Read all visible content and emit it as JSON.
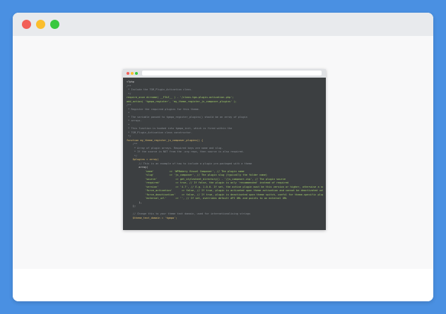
{
  "code": {
    "lines": [
      {
        "text": "<?php",
        "kind": "plain"
      },
      {
        "text": "/**",
        "kind": "comment"
      },
      {
        "text": " * Include the TGM_Plugin_Activation class.",
        "kind": "comment"
      },
      {
        "text": " */",
        "kind": "comment"
      },
      {
        "text": "require_once dirname( __FILE__ ) . '/class-tgm-plugin-activation.php';",
        "kind": "string"
      },
      {
        "text": "add_action( 'tgmpa_register', 'my_theme_register_js_composer_plugins' );",
        "kind": "string"
      },
      {
        "text": "/**",
        "kind": "comment"
      },
      {
        "text": " * Register the required plugins for this theme.",
        "kind": "comment"
      },
      {
        "text": " *",
        "kind": "comment"
      },
      {
        "text": " * The variable passed to tgmpa_register_plugins() should be an array of plugin",
        "kind": "comment"
      },
      {
        "text": " * arrays.",
        "kind": "comment"
      },
      {
        "text": " *",
        "kind": "comment"
      },
      {
        "text": " * This function is hooked into tgmpa_init, which is fired within the",
        "kind": "comment"
      },
      {
        "text": " * TGM_Plugin_Activation class constructor.",
        "kind": "comment"
      },
      {
        "text": " */",
        "kind": "comment"
      },
      {
        "text": "function my_theme_register_js_composer_plugins() {",
        "kind": "keyword"
      },
      {
        "text": "    /**",
        "kind": "comment"
      },
      {
        "text": "     * Array of plugin arrays. Required keys are name and slug.",
        "kind": "comment"
      },
      {
        "text": "     * If the source is NOT from the .org repo, then source is also required.",
        "kind": "comment"
      },
      {
        "text": "     */",
        "kind": "comment"
      },
      {
        "text": "    $plugins = array(",
        "kind": "keyword"
      },
      {
        "text": "        // This is an example of how to include a plugin pre-packaged with a theme",
        "kind": "comment"
      },
      {
        "text": "        array(",
        "kind": "plain"
      },
      {
        "text": "            'name'          => 'WPBakery Visual Composer', // The plugin name",
        "kind": "string"
      },
      {
        "text": "            'slug'          => 'js_composer', // The plugin slug (typically the folder name)",
        "kind": "string"
      },
      {
        "text": "            'source'            => get_stylesheet_directory() . '/js_composer.zip', // The plugin source",
        "kind": "string"
      },
      {
        "text": "            'required'          => true, // If false, the plugin is only 'recommended' instead of required",
        "kind": "string"
      },
      {
        "text": "            'version'           => '4.7', // E.g. 1.0.0. If set, the active plugin must be this version or higher, otherwise a notice is presented",
        "kind": "string"
      },
      {
        "text": "            'force_activation'      => false, // If true, plugin is activated upon theme activation and cannot be deactivated until theme switch",
        "kind": "string"
      },
      {
        "text": "            'force_deactivation'    => false, // If true, plugin is deactivated upon theme switch, useful for theme-specific plugins",
        "kind": "string"
      },
      {
        "text": "            'external_url'      => '', // If set, overrides default API URL and points to an external URL",
        "kind": "string"
      },
      {
        "text": "        ),",
        "kind": "plain"
      },
      {
        "text": "    );",
        "kind": "plain"
      },
      {
        "text": "",
        "kind": "plain"
      },
      {
        "text": "    // Change this to your theme text domain, used for internationalising strings",
        "kind": "comment"
      },
      {
        "text": "    $theme_text_domain = 'tgmpa';",
        "kind": "keyword"
      }
    ]
  }
}
